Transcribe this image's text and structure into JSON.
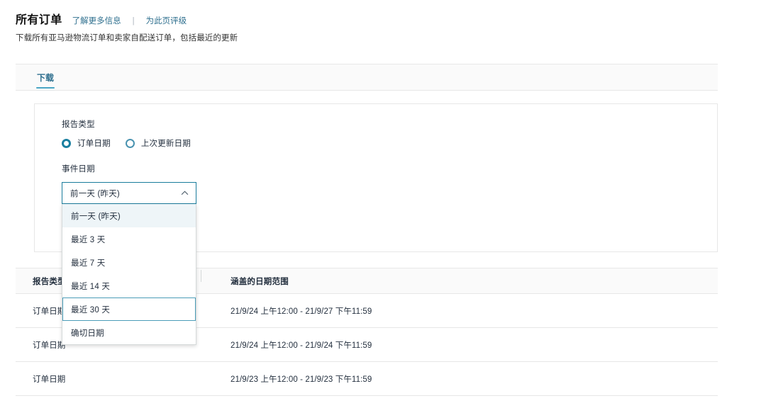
{
  "header": {
    "title": "所有订单",
    "learn_more_link": "了解更多信息",
    "separator": "|",
    "rate_page_link": "为此页评级",
    "subtitle": "下载所有亚马逊物流订单和卖家自配送订单，包括最近的更新"
  },
  "tabs": [
    {
      "label": "下载",
      "active": true
    }
  ],
  "filters": {
    "report_type_label": "报告类型",
    "radios": [
      {
        "label": "订单日期",
        "checked": true
      },
      {
        "label": "上次更新日期",
        "checked": false
      }
    ],
    "event_date_label": "事件日期",
    "select": {
      "value": "前一天 (昨天)",
      "expanded": true,
      "chevron_icon": "chevron-up-icon",
      "options": [
        {
          "label": "前一天 (昨天)",
          "selected": true,
          "hovered": false
        },
        {
          "label": "最近 3 天",
          "selected": false,
          "hovered": false
        },
        {
          "label": "最近 7 天",
          "selected": false,
          "hovered": false
        },
        {
          "label": "最近 14 天",
          "selected": false,
          "hovered": false
        },
        {
          "label": "最近 30 天",
          "selected": false,
          "hovered": true
        },
        {
          "label": "确切日期",
          "selected": false,
          "hovered": false
        }
      ]
    }
  },
  "table": {
    "columns": [
      "报告类型",
      "涵盖的日期范围"
    ],
    "rows": [
      {
        "report_type": "订单日期",
        "date_range": "21/9/24 上午12:00 - 21/9/27 下午11:59"
      },
      {
        "report_type": "订单日期",
        "date_range": "21/9/24 上午12:00 - 21/9/24 下午11:59"
      },
      {
        "report_type": "订单日期",
        "date_range": "21/9/23 上午12:00 - 21/9/23 下午11:59"
      }
    ]
  },
  "colors": {
    "accent": "#1a7c9c",
    "link": "#2e6f8e",
    "tab_underline": "#49a5c4",
    "border": "#e7e7e7",
    "selected_bg": "#eef5f8"
  }
}
